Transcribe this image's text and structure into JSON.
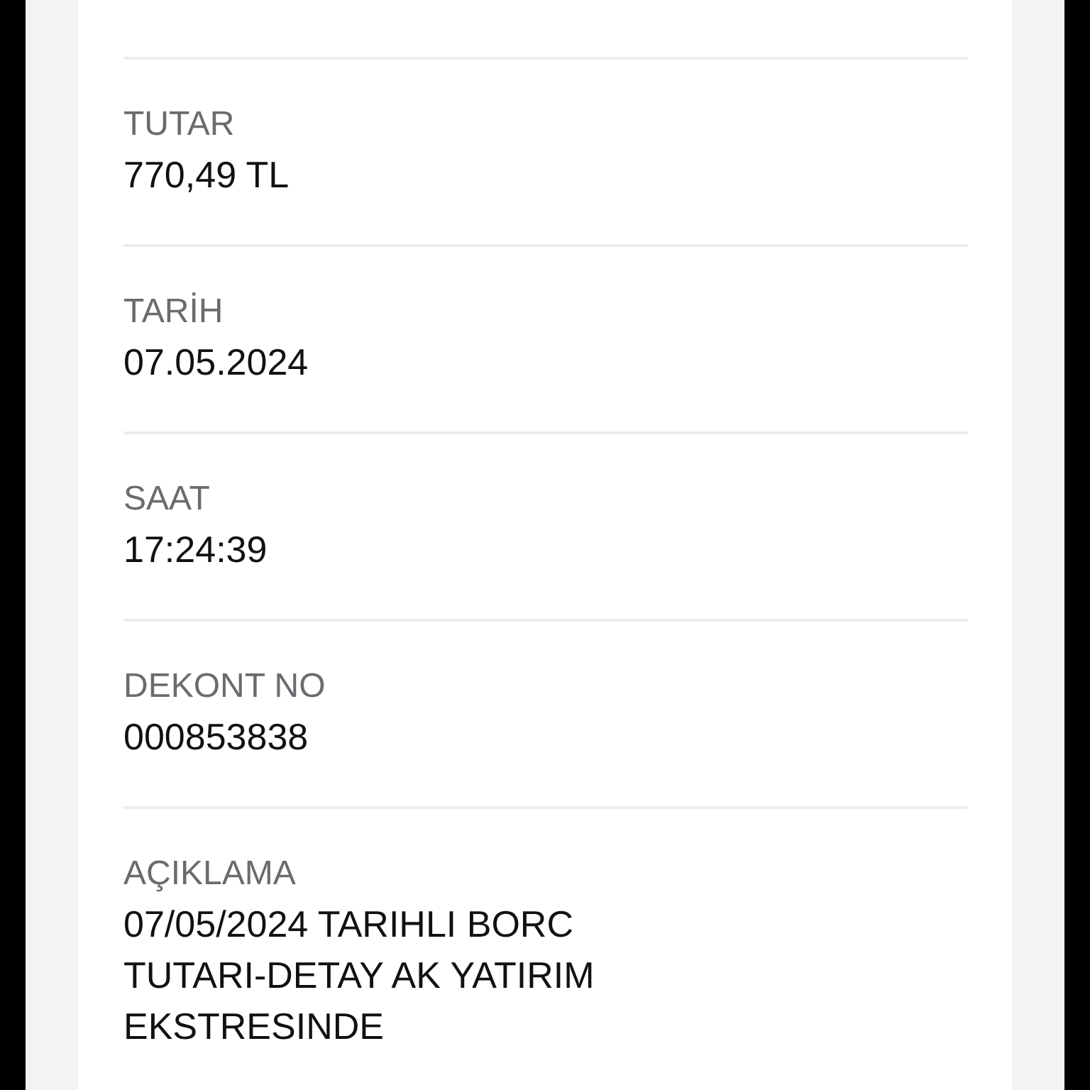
{
  "fields": [
    {
      "label": "TUTAR",
      "value": "770,49 TL"
    },
    {
      "label": "TARİH",
      "value": "07.05.2024"
    },
    {
      "label": "SAAT",
      "value": "17:24:39"
    },
    {
      "label": "DEKONT NO",
      "value": "000853838"
    },
    {
      "label": "AÇIKLAMA",
      "value": "07/05/2024 TARIHLI BORC TUTARI-DETAY AK YATIRIM EKSTRESINDE"
    }
  ]
}
